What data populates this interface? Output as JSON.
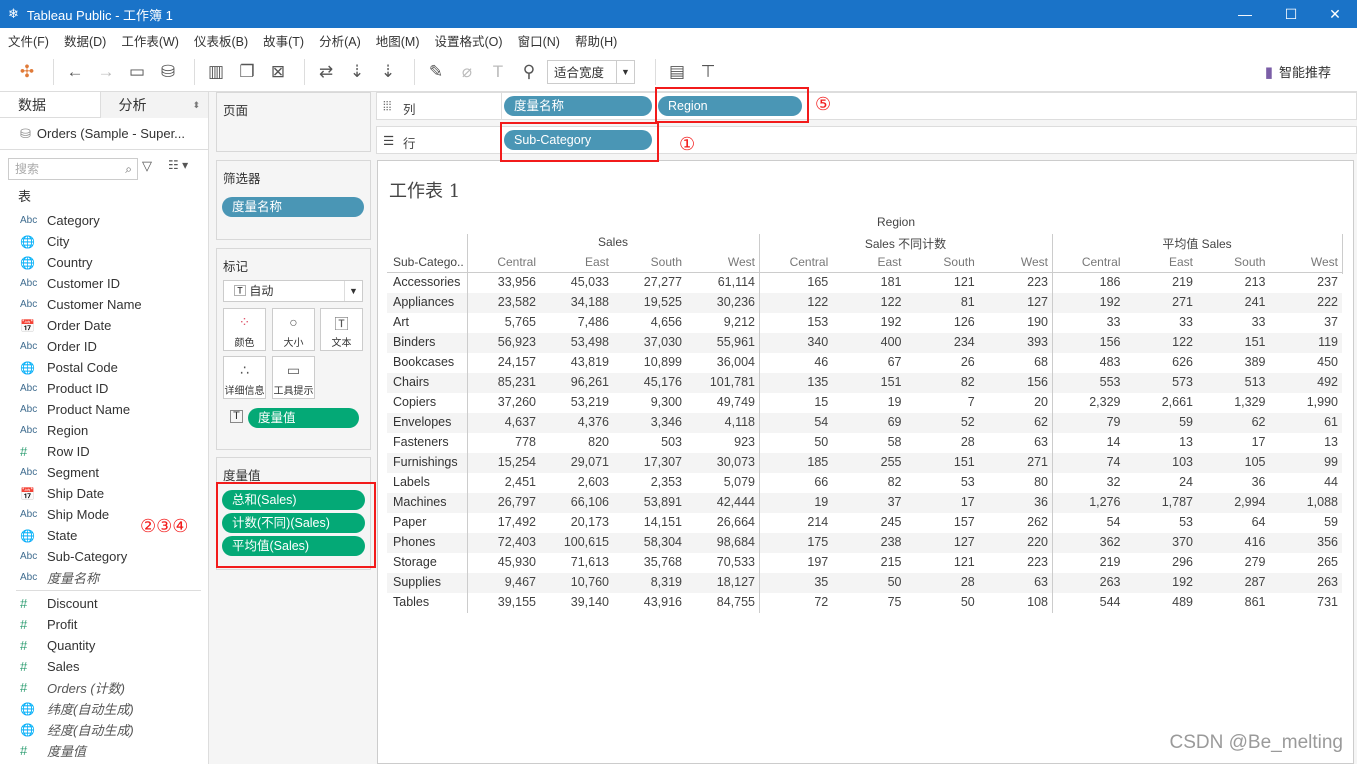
{
  "window": {
    "title": "Tableau Public - 工作簿 1",
    "controls": [
      "—",
      "☐",
      "✕"
    ]
  },
  "menu": [
    "文件(F)",
    "数据(D)",
    "工作表(W)",
    "仪表板(B)",
    "故事(T)",
    "分析(A)",
    "地图(M)",
    "设置格式(O)",
    "窗口(N)",
    "帮助(H)"
  ],
  "toolbar": {
    "fit": "适合宽度",
    "smart": "智能推荐"
  },
  "left": {
    "tabs": [
      "数据",
      "分析"
    ],
    "datasource": "Orders (Sample - Super...",
    "search_placeholder": "搜索",
    "section": "表",
    "dimensions": [
      {
        "type": "abc",
        "name": "Category"
      },
      {
        "type": "geo",
        "name": "City"
      },
      {
        "type": "geo",
        "name": "Country"
      },
      {
        "type": "abc",
        "name": "Customer ID"
      },
      {
        "type": "abc",
        "name": "Customer Name"
      },
      {
        "type": "date",
        "name": "Order Date"
      },
      {
        "type": "abc",
        "name": "Order ID"
      },
      {
        "type": "geo",
        "name": "Postal Code"
      },
      {
        "type": "abc",
        "name": "Product ID"
      },
      {
        "type": "abc",
        "name": "Product Name"
      },
      {
        "type": "abc",
        "name": "Region"
      },
      {
        "type": "num",
        "name": "Row ID"
      },
      {
        "type": "abc",
        "name": "Segment"
      },
      {
        "type": "date",
        "name": "Ship Date"
      },
      {
        "type": "abc",
        "name": "Ship Mode"
      },
      {
        "type": "geo",
        "name": "State"
      },
      {
        "type": "abc",
        "name": "Sub-Category"
      },
      {
        "type": "abc",
        "name": "度量名称",
        "italic": true
      }
    ],
    "measures": [
      {
        "type": "num",
        "name": "Discount"
      },
      {
        "type": "num",
        "name": "Profit"
      },
      {
        "type": "num",
        "name": "Quantity"
      },
      {
        "type": "num",
        "name": "Sales"
      },
      {
        "type": "num",
        "name": "Orders (计数)",
        "italic": true
      },
      {
        "type": "geo",
        "name": "纬度(自动生成)",
        "italic": true
      },
      {
        "type": "geo",
        "name": "经度(自动生成)",
        "italic": true
      },
      {
        "type": "num",
        "name": "度量值",
        "italic": true
      }
    ]
  },
  "cards": {
    "pages": "页面",
    "filters": {
      "title": "筛选器",
      "pill": "度量名称"
    },
    "marks": {
      "title": "标记",
      "type": "自动",
      "buttons": [
        "颜色",
        "大小",
        "文本",
        "详细信息",
        "工具提示"
      ],
      "pill": "度量值"
    },
    "measure_values": {
      "title": "度量值",
      "pills": [
        "总和(Sales)",
        "计数(不同)(Sales)",
        "平均值(Sales)"
      ]
    }
  },
  "shelves": {
    "columns": {
      "label": "列",
      "pills": [
        "度量名称",
        "Region"
      ]
    },
    "rows": {
      "label": "行",
      "pills": [
        "Sub-Category"
      ]
    }
  },
  "annotations": {
    "a1": "①",
    "a234": "②③④",
    "a5": "⑤"
  },
  "sheet": {
    "title": "工作表 1",
    "col_header": "Region",
    "row_header": "Sub-Catego..",
    "measures": [
      "Sales",
      "Sales 不同计数",
      "平均值 Sales"
    ],
    "regions": [
      "Central",
      "East",
      "South",
      "West"
    ],
    "rows": [
      [
        "Accessories",
        "33,956",
        "45,033",
        "27,277",
        "61,114",
        "165",
        "181",
        "121",
        "223",
        "186",
        "219",
        "213",
        "237"
      ],
      [
        "Appliances",
        "23,582",
        "34,188",
        "19,525",
        "30,236",
        "122",
        "122",
        "81",
        "127",
        "192",
        "271",
        "241",
        "222"
      ],
      [
        "Art",
        "5,765",
        "7,486",
        "4,656",
        "9,212",
        "153",
        "192",
        "126",
        "190",
        "33",
        "33",
        "33",
        "37"
      ],
      [
        "Binders",
        "56,923",
        "53,498",
        "37,030",
        "55,961",
        "340",
        "400",
        "234",
        "393",
        "156",
        "122",
        "151",
        "119"
      ],
      [
        "Bookcases",
        "24,157",
        "43,819",
        "10,899",
        "36,004",
        "46",
        "67",
        "26",
        "68",
        "483",
        "626",
        "389",
        "450"
      ],
      [
        "Chairs",
        "85,231",
        "96,261",
        "45,176",
        "101,781",
        "135",
        "151",
        "82",
        "156",
        "553",
        "573",
        "513",
        "492"
      ],
      [
        "Copiers",
        "37,260",
        "53,219",
        "9,300",
        "49,749",
        "15",
        "19",
        "7",
        "20",
        "2,329",
        "2,661",
        "1,329",
        "1,990"
      ],
      [
        "Envelopes",
        "4,637",
        "4,376",
        "3,346",
        "4,118",
        "54",
        "69",
        "52",
        "62",
        "79",
        "59",
        "62",
        "61"
      ],
      [
        "Fasteners",
        "778",
        "820",
        "503",
        "923",
        "50",
        "58",
        "28",
        "63",
        "14",
        "13",
        "17",
        "13"
      ],
      [
        "Furnishings",
        "15,254",
        "29,071",
        "17,307",
        "30,073",
        "185",
        "255",
        "151",
        "271",
        "74",
        "103",
        "105",
        "99"
      ],
      [
        "Labels",
        "2,451",
        "2,603",
        "2,353",
        "5,079",
        "66",
        "82",
        "53",
        "80",
        "32",
        "24",
        "36",
        "44"
      ],
      [
        "Machines",
        "26,797",
        "66,106",
        "53,891",
        "42,444",
        "19",
        "37",
        "17",
        "36",
        "1,276",
        "1,787",
        "2,994",
        "1,088"
      ],
      [
        "Paper",
        "17,492",
        "20,173",
        "14,151",
        "26,664",
        "214",
        "245",
        "157",
        "262",
        "54",
        "53",
        "64",
        "59"
      ],
      [
        "Phones",
        "72,403",
        "100,615",
        "58,304",
        "98,684",
        "175",
        "238",
        "127",
        "220",
        "362",
        "370",
        "416",
        "356"
      ],
      [
        "Storage",
        "45,930",
        "71,613",
        "35,768",
        "70,533",
        "197",
        "215",
        "121",
        "223",
        "219",
        "296",
        "279",
        "265"
      ],
      [
        "Supplies",
        "9,467",
        "10,760",
        "8,319",
        "18,127",
        "35",
        "50",
        "28",
        "63",
        "263",
        "192",
        "287",
        "263"
      ],
      [
        "Tables",
        "39,155",
        "39,140",
        "43,916",
        "84,755",
        "72",
        "75",
        "50",
        "108",
        "544",
        "489",
        "861",
        "731"
      ]
    ]
  },
  "watermark": "CSDN @Be_melting",
  "colors": {
    "titlebar": "#1a73c8",
    "dimension_pill": "#4a96b5",
    "measure_pill": "#04a976",
    "annotation": "#f21b1b"
  }
}
